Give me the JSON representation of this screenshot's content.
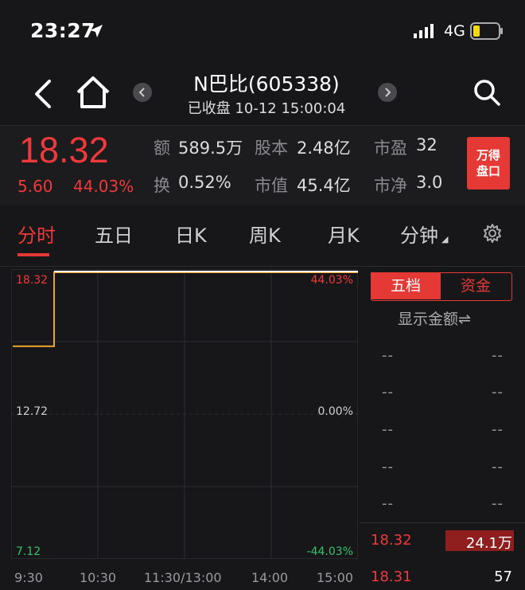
{
  "status": {
    "time": "23:27",
    "network": "4G"
  },
  "header": {
    "title": "N巴比(605338)",
    "subtitle": "已收盘 10-12 15:00:04"
  },
  "quote": {
    "price": "18.32",
    "change": "5.60",
    "change_pct": "44.03%",
    "fields": [
      {
        "label": "额",
        "value": "589.5万"
      },
      {
        "label": "股本",
        "value": "2.48亿"
      },
      {
        "label": "市盈",
        "value": "32"
      },
      {
        "label": "换",
        "value": "0.52%"
      },
      {
        "label": "市值",
        "value": "45.4亿"
      },
      {
        "label": "市净",
        "value": "3.0"
      }
    ],
    "wind_label_1": "万得",
    "wind_label_2": "盘口",
    "accent": "#ee3a3a"
  },
  "tabs": [
    {
      "label": "分时",
      "active": true
    },
    {
      "label": "五日"
    },
    {
      "label": "日K"
    },
    {
      "label": "周K"
    },
    {
      "label": "月K"
    },
    {
      "label": "分钟"
    }
  ],
  "chart": {
    "y_top": "18.32",
    "y_mid": "12.72",
    "y_bot": "7.12",
    "pct_top": "44.03%",
    "pct_mid": "0.00%",
    "pct_bot": "-44.03%",
    "x_labels": [
      "9:30",
      "10:30",
      "11:30/13:00",
      "14:00",
      "15:00"
    ],
    "colors": {
      "price_line": "#f0a030",
      "avg_line": "#ffffff",
      "up": "#ee3a3a",
      "down": "#36c26a"
    }
  },
  "chart_data": {
    "type": "line",
    "x": [
      "9:30",
      "9:35",
      "9:40",
      "9:45",
      "10:30",
      "11:30/13:00",
      "14:00",
      "15:00"
    ],
    "series": [
      {
        "values": [
          15.4,
          15.4,
          15.4,
          18.32,
          18.32,
          18.32,
          18.32,
          18.32
        ]
      },
      {
        "values": [
          18.32,
          18.32,
          18.32,
          18.32,
          18.32,
          18.32,
          18.32,
          18.32
        ]
      }
    ],
    "ylim": [
      7.12,
      18.32
    ],
    "y_pct_range": [
      -44.03,
      44.03
    ],
    "grid": true
  },
  "side": {
    "tab_order": "五档",
    "tab_fund": "资金",
    "toggle": "显示金额⇌",
    "placeholder": "--",
    "trades": [
      {
        "price": "18.32",
        "volume": "24.1万"
      },
      {
        "price": "18.31",
        "volume": "57"
      }
    ]
  }
}
